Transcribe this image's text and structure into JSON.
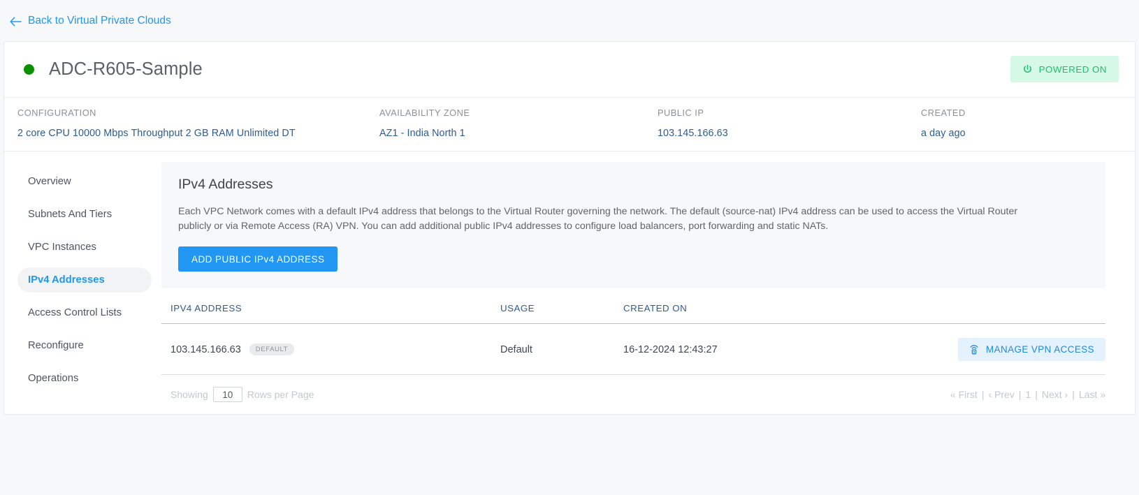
{
  "back": {
    "label": "Back to Virtual Private Clouds",
    "icon": "arrow-left-icon"
  },
  "header": {
    "title": "ADC-R605-Sample",
    "status_dot_color": "#0b9000",
    "power_badge": {
      "label": "POWERED ON",
      "icon": "power-icon",
      "color": "#15c26b",
      "bg": "#d6f8e6"
    }
  },
  "meta": [
    {
      "label": "CONFIGURATION",
      "value": "2 core CPU 10000 Mbps Throughput 2 GB RAM Unlimited DT"
    },
    {
      "label": "AVAILABILITY ZONE",
      "value": "AZ1 - India North 1"
    },
    {
      "label": "PUBLIC IP",
      "value": "103.145.166.63"
    },
    {
      "label": "CREATED",
      "value": "a day ago"
    }
  ],
  "sidebar": {
    "items": [
      {
        "label": "Overview",
        "active": false
      },
      {
        "label": "Subnets And Tiers",
        "active": false
      },
      {
        "label": "VPC Instances",
        "active": false
      },
      {
        "label": "IPv4 Addresses",
        "active": true
      },
      {
        "label": "Access Control Lists",
        "active": false
      },
      {
        "label": "Reconfigure",
        "active": false
      },
      {
        "label": "Operations",
        "active": false
      }
    ]
  },
  "panel": {
    "title": "IPv4 Addresses",
    "description": "Each VPC Network comes with a default IPv4 address that belongs to the Virtual Router governing the network. The default (source-nat) IPv4 address can be used to access the Virtual Router publicly or via Remote Access (RA) VPN. You can add additional public IPv4 addresses to configure load balancers, port forwarding and static NATs.",
    "add_button": "ADD PUBLIC IPv4 ADDRESS"
  },
  "table": {
    "columns": [
      "IPV4 ADDRESS",
      "USAGE",
      "CREATED ON",
      ""
    ],
    "rows": [
      {
        "ip": "103.145.166.63",
        "badge": "DEFAULT",
        "usage": "Default",
        "created_on": "16-12-2024 12:43:27",
        "action": {
          "label": "MANAGE VPN ACCESS",
          "icon": "vpn-broadcast-icon"
        }
      }
    ]
  },
  "footer": {
    "showing_label": "Showing",
    "rows_per_page_value": "10",
    "rows_per_page_label": "Rows per Page",
    "pager": {
      "first": "« First",
      "prev": "‹ Prev",
      "current": "1",
      "next": "Next ›",
      "last": "Last »",
      "sep": "|"
    }
  }
}
